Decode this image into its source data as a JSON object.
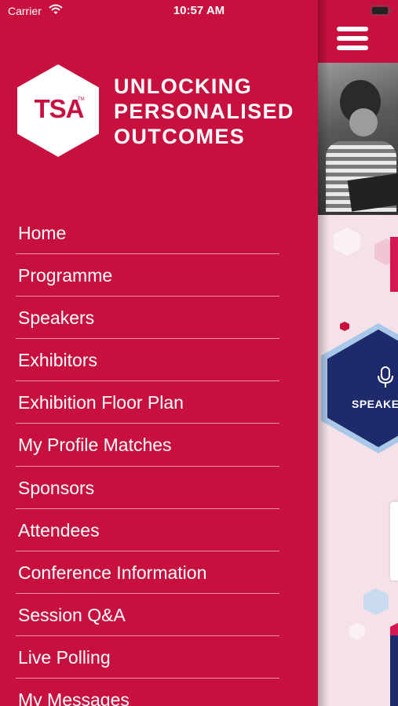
{
  "status_bar": {
    "carrier": "Carrier",
    "time": "10:57 AM"
  },
  "logo": {
    "mark": "TSA",
    "tm": "TM"
  },
  "tagline": [
    "UNLOCKING",
    "PERSONALISED",
    "OUTCOMES"
  ],
  "nav": {
    "items": [
      {
        "label": "Home"
      },
      {
        "label": "Programme"
      },
      {
        "label": "Speakers"
      },
      {
        "label": "Exhibitors"
      },
      {
        "label": "Exhibition Floor Plan"
      },
      {
        "label": "My Profile Matches"
      },
      {
        "label": "Sponsors"
      },
      {
        "label": "Attendees"
      },
      {
        "label": "Conference Information"
      },
      {
        "label": "Session Q&A"
      },
      {
        "label": "Live Polling"
      },
      {
        "label": "My Messages"
      }
    ]
  },
  "background_content": {
    "speakers_label": "SPEAKE"
  },
  "colors": {
    "brand": "#c8103f",
    "navy": "#1d2a6b",
    "light_pink": "#f5e1e8"
  },
  "icons": {
    "wifi": "wifi-icon",
    "battery": "battery-icon",
    "menu": "hamburger-menu-icon",
    "mic": "microphone-icon"
  }
}
